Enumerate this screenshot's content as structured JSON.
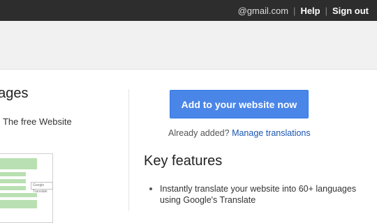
{
  "topbar": {
    "email": "@gmail.com",
    "help": "Help",
    "signout": "Sign out",
    "separator": "|"
  },
  "left": {
    "title": "uages",
    "text": "! The free Website",
    "thumb_widget_label": "Google Translate"
  },
  "cta": {
    "label": "Add to your website now"
  },
  "already": {
    "text": "Already added?",
    "link": "Manage translations"
  },
  "key_features": {
    "title": "Key features",
    "items": [
      "Instantly translate your website into 60+ languages using Google's Translate"
    ]
  },
  "colors": {
    "topbar": "#2d2d2d",
    "band": "#f1f1f1",
    "cta": "#4a86e8",
    "link": "#1a55b0",
    "thumb_green": "#b9e0b2"
  }
}
